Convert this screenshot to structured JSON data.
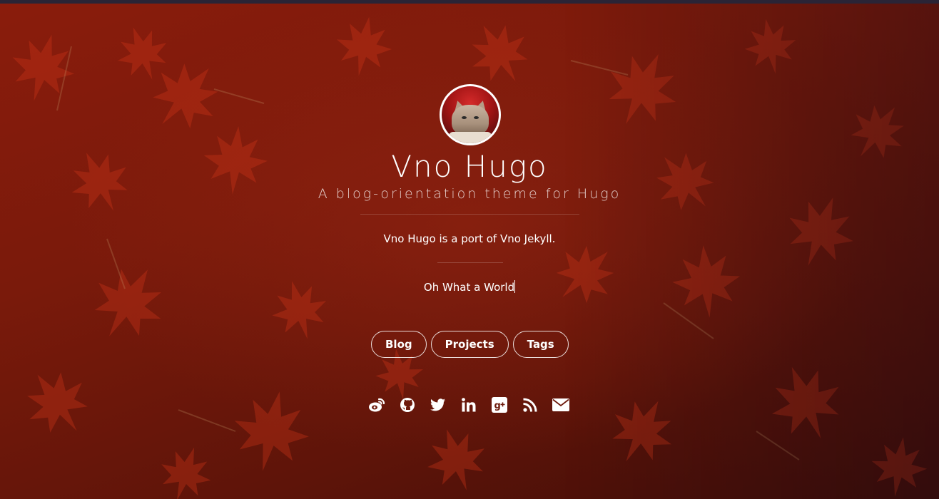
{
  "site": {
    "title": "Vno Hugo",
    "subtitle": "A blog-orientation theme for Hugo",
    "description": "Vno Hugo is a port of Vno Jekyll.",
    "typed_text": "Oh What a World"
  },
  "nav": {
    "items": [
      {
        "label": "Blog"
      },
      {
        "label": "Projects"
      },
      {
        "label": "Tags"
      }
    ]
  },
  "social": {
    "icons": [
      "weibo-icon",
      "github-icon",
      "twitter-icon",
      "linkedin-icon",
      "google-plus-icon",
      "rss-icon",
      "email-icon"
    ]
  },
  "colors": {
    "background": "#7a1a0b",
    "text": "#ffffff",
    "topbar": "#2a2436"
  }
}
